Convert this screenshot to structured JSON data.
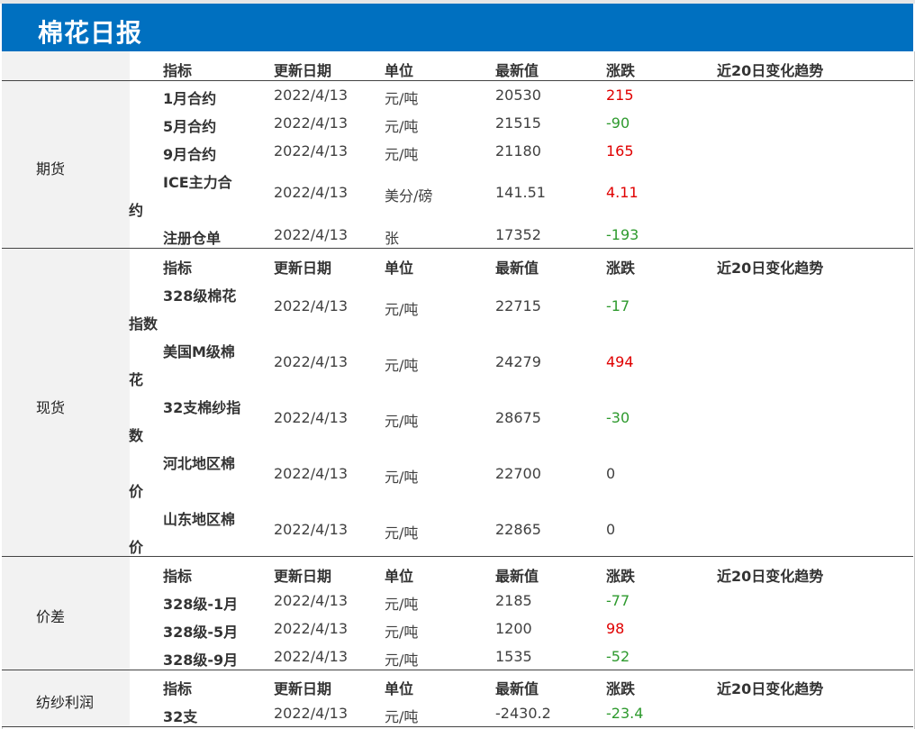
{
  "title": "棉花日报",
  "columns": [
    "指标",
    "更新日期",
    "单位",
    "最新值",
    "涨跌",
    "近20日变化趋势"
  ],
  "sections": [
    {
      "category": "期货",
      "rows": [
        {
          "name": "1月合约",
          "date": "2022/4/13",
          "unit": "元/吨",
          "value": "20530",
          "change": "215"
        },
        {
          "name": "5月合约",
          "date": "2022/4/13",
          "unit": "元/吨",
          "value": "21515",
          "change": "-90"
        },
        {
          "name": "9月合约",
          "date": "2022/4/13",
          "unit": "元/吨",
          "value": "21180",
          "change": "165"
        },
        {
          "name": "ICE主力合",
          "name_wrap": "约",
          "date": "2022/4/13",
          "unit": "美分/磅",
          "value": "141.51",
          "change": "4.11"
        },
        {
          "name": "注册仓单",
          "date": "2022/4/13",
          "unit": "张",
          "value": "17352",
          "change": "-193"
        }
      ]
    },
    {
      "category": "现货",
      "rows": [
        {
          "name": "328级棉花",
          "name_wrap": "指数",
          "date": "2022/4/13",
          "unit": "元/吨",
          "value": "22715",
          "change": "-17"
        },
        {
          "name": "美国M级棉",
          "name_wrap": "花",
          "date": "2022/4/13",
          "unit": "元/吨",
          "value": "24279",
          "change": "494"
        },
        {
          "name": "32支棉纱指",
          "name_wrap": "数",
          "date": "2022/4/13",
          "unit": "元/吨",
          "value": "28675",
          "change": "-30"
        },
        {
          "name": "河北地区棉",
          "name_wrap": "价",
          "date": "2022/4/13",
          "unit": "元/吨",
          "value": "22700",
          "change": "0"
        },
        {
          "name": "山东地区棉",
          "name_wrap": "价",
          "date": "2022/4/13",
          "unit": "元/吨",
          "value": "22865",
          "change": "0"
        }
      ]
    },
    {
      "category": "价差",
      "rows": [
        {
          "name": "328级-1月",
          "date": "2022/4/13",
          "unit": "元/吨",
          "value": "2185",
          "change": "-77"
        },
        {
          "name": "328级-5月",
          "date": "2022/4/13",
          "unit": "元/吨",
          "value": "1200",
          "change": "98"
        },
        {
          "name": "328级-9月",
          "date": "2022/4/13",
          "unit": "元/吨",
          "value": "1535",
          "change": "-52"
        }
      ]
    },
    {
      "category": "纺纱利润",
      "rows": [
        {
          "name": "32支",
          "date": "2022/4/13",
          "unit": "元/吨",
          "value": "-2430.2",
          "change": "-23.4"
        }
      ]
    }
  ],
  "colors": {
    "header": "#0070c0",
    "up": "#e00000",
    "down": "#2e9a2e"
  }
}
